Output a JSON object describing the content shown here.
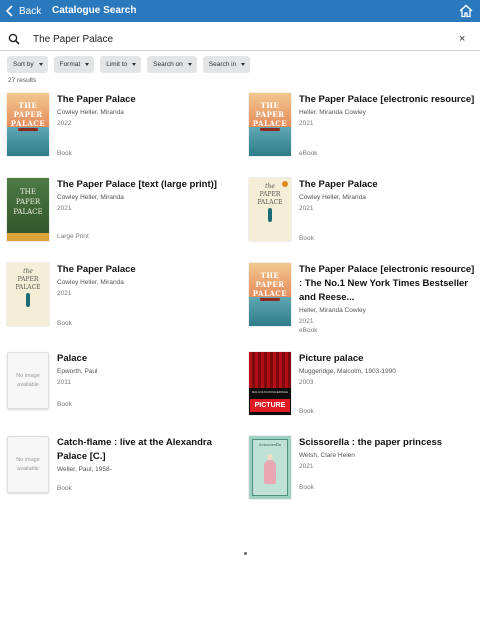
{
  "header": {
    "back_label": "Back",
    "title": "Catalogue Search",
    "accent": "#2b79bd"
  },
  "search": {
    "value": "The Paper Palace",
    "placeholder": "Search",
    "clear_icon": "×"
  },
  "filters": [
    {
      "label": "Sort by"
    },
    {
      "label": "Format"
    },
    {
      "label": "Limit to"
    },
    {
      "label": "Search on"
    },
    {
      "label": "Search in"
    }
  ],
  "results_count": "27 results",
  "results": [
    {
      "title": "The Paper Palace",
      "author": "Cowley Heller, Miranda",
      "year": "2022",
      "format": "Book",
      "cover": "pp",
      "cover_text": [
        "THE",
        "PAPER",
        "PALACE"
      ]
    },
    {
      "title": "The Paper Palace [electronic resource]",
      "author": "Heller, Miranda Cowley",
      "year": "2021",
      "format": "eBook",
      "cover": "pp",
      "cover_text": [
        "THE",
        "PAPER",
        "PALACE"
      ]
    },
    {
      "title": "The Paper Palace [text (large print)]",
      "author": "Cowley Heller, Miranda",
      "year": "2021",
      "format": "Large Print",
      "cover": "lp",
      "cover_text": [
        "THE",
        "PAPER",
        "PALACE"
      ]
    },
    {
      "title": "The Paper Palace",
      "author": "Cowley Heller, Miranda",
      "year": "2021",
      "format": "Book",
      "cover": "cream",
      "cover_text": [
        "the",
        "PAPER",
        "PALACE"
      ]
    },
    {
      "title": "The Paper Palace",
      "author": "Cowley Heller, Miranda",
      "year": "2021",
      "format": "Book",
      "cover": "cream",
      "cover_text": [
        "the",
        "PAPER",
        "PALACE"
      ]
    },
    {
      "title": "The Paper Palace [electronic resource] : The No.1 New York Times Bestseller and Reese...",
      "author": "Heller, Miranda Cowley",
      "year": "2021",
      "format": "eBook",
      "cover": "pp",
      "cover_text": [
        "THE",
        "PAPER",
        "PALACE"
      ]
    },
    {
      "title": "Palace",
      "author": "Epworth, Paul",
      "year": "2011",
      "format": "Book",
      "cover": "none",
      "cover_text": [
        "No image available"
      ]
    },
    {
      "title": "Picture palace",
      "author": "Muggeridge, Malcolm, 1903-1990",
      "year": "2003",
      "format": "Book",
      "cover": "pic",
      "cover_text": [
        "MALCOLM MUGGERIDGE",
        "PICTURE PALACE"
      ]
    },
    {
      "title": "Catch-flame : live at the Alexandra Palace [C.]",
      "author": "Weller, Paul, 1958-",
      "year": "",
      "format": "Book",
      "cover": "none",
      "cover_text": [
        "No image available"
      ]
    },
    {
      "title": "Scissorella : the paper princess",
      "author": "Welsh, Clare Helen",
      "year": "2021",
      "format": "Book",
      "cover": "sc",
      "cover_text": [
        "Scissorella"
      ]
    }
  ]
}
